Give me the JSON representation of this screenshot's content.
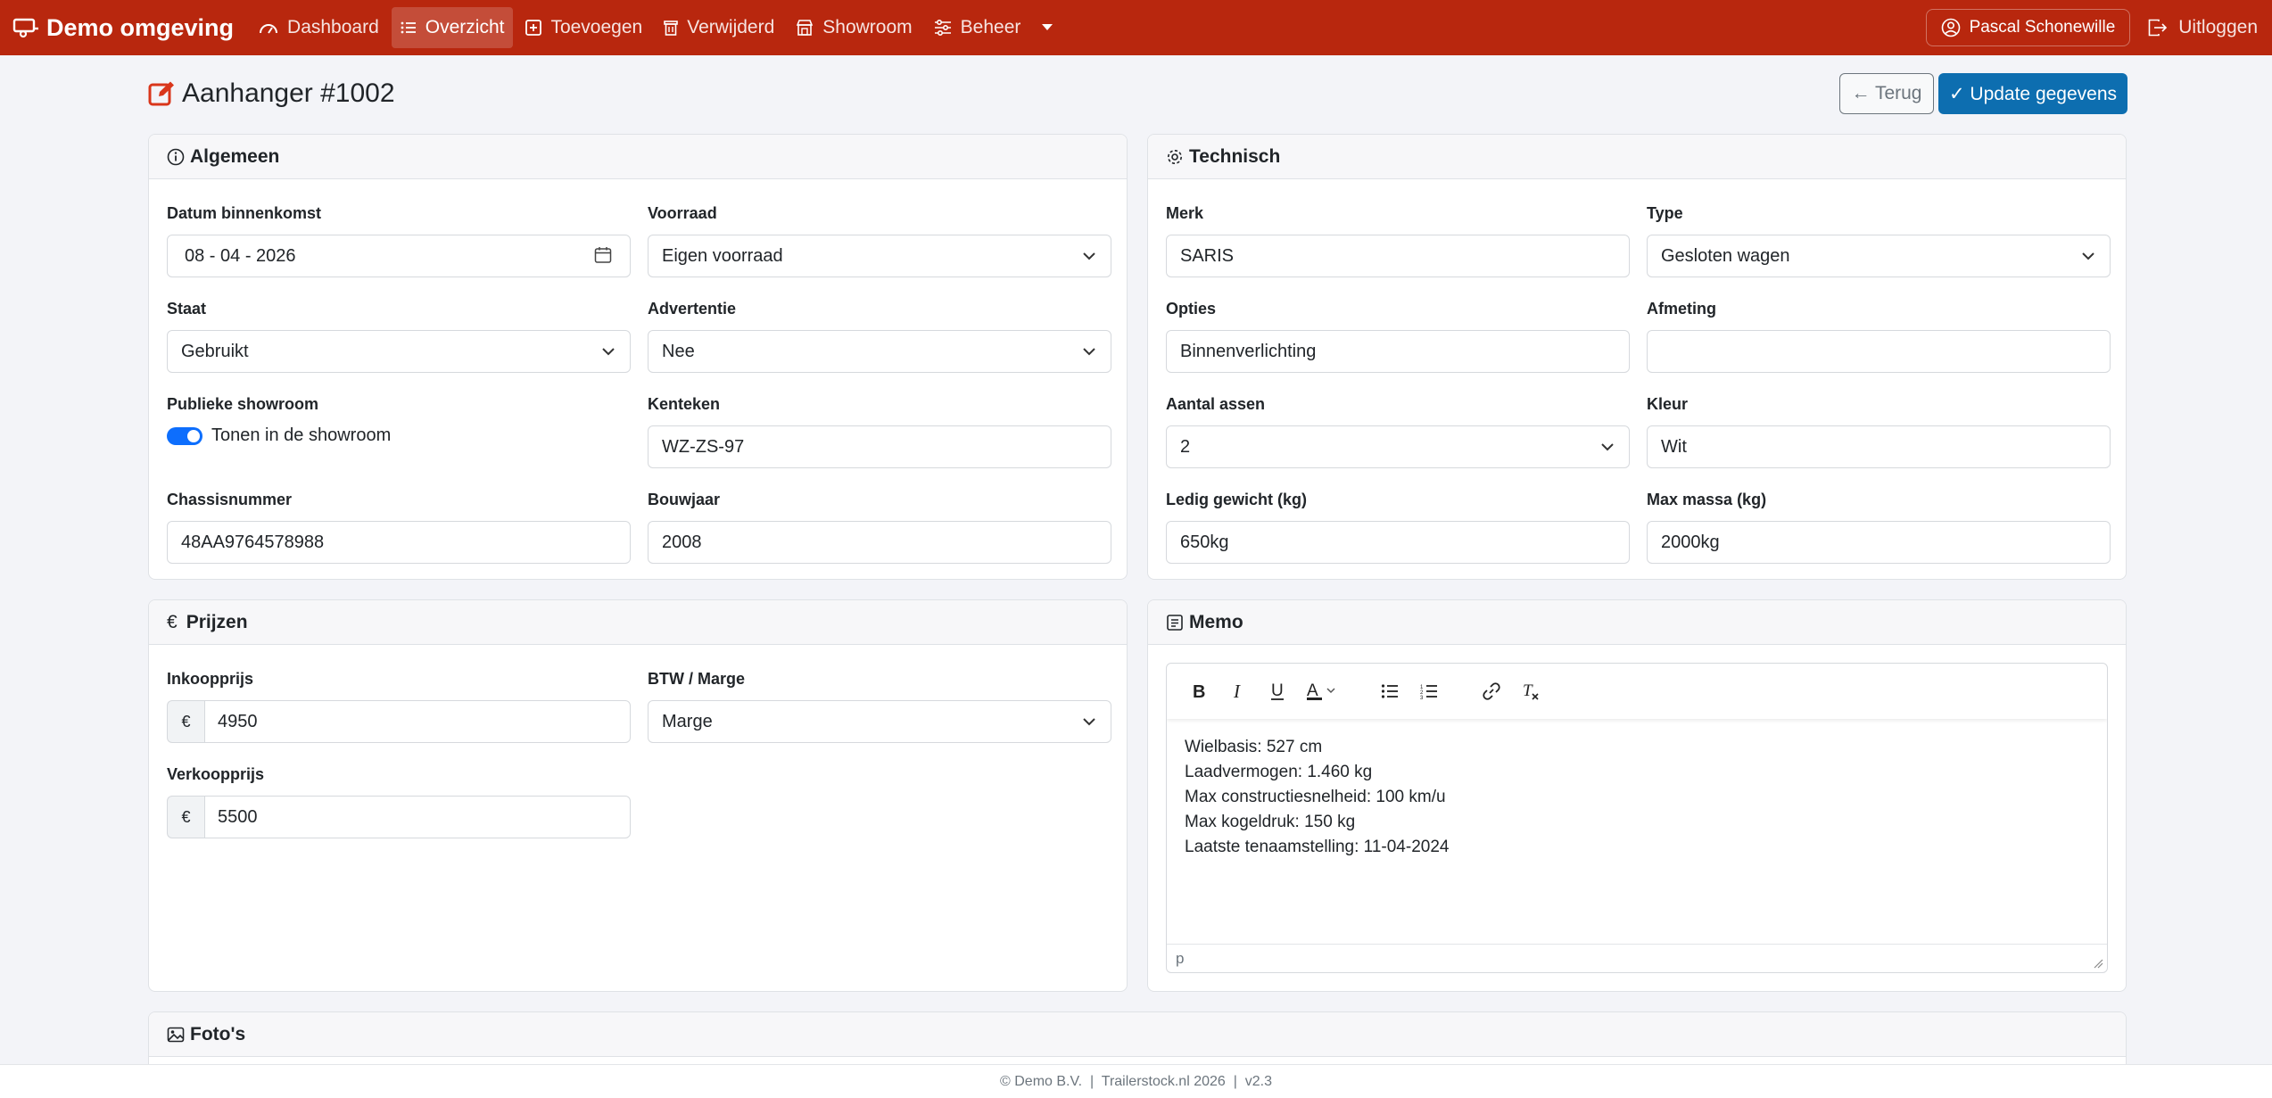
{
  "navbar": {
    "brand": "Demo omgeving",
    "items": [
      {
        "label": "Dashboard",
        "icon": "dashboard-icon"
      },
      {
        "label": "Overzicht",
        "icon": "list-icon",
        "active": true
      },
      {
        "label": "Toevoegen",
        "icon": "plus-square-icon"
      },
      {
        "label": "Verwijderd",
        "icon": "trash-icon"
      },
      {
        "label": "Showroom",
        "icon": "shop-icon"
      },
      {
        "label": "Beheer",
        "icon": "sliders-icon"
      }
    ],
    "user": "Pascal Schonewille",
    "logout": "Uitloggen",
    "color": "#b8270e"
  },
  "header": {
    "title": "Aanhanger #1002",
    "back_label": "← Terug",
    "update_label": "✓ Update gegevens"
  },
  "algemeen": {
    "title": "Algemeen",
    "datum_label": "Datum binnenkomst",
    "datum_value": "08 - 04 - 2026",
    "voorraad_label": "Voorraad",
    "voorraad_value": "Eigen voorraad",
    "staat_label": "Staat",
    "staat_value": "Gebruikt",
    "advertentie_label": "Advertentie",
    "advertentie_value": "Nee",
    "showroom_label": "Publieke showroom",
    "showroom_switch_label": "Tonen in de showroom",
    "kenteken_label": "Kenteken",
    "kenteken_value": "WZ-ZS-97",
    "chassis_label": "Chassisnummer",
    "chassis_value": "48AA9764578988",
    "bouwjaar_label": "Bouwjaar",
    "bouwjaar_value": "2008"
  },
  "technisch": {
    "title": "Technisch",
    "merk_label": "Merk",
    "merk_value": "SARIS",
    "type_label": "Type",
    "type_value": "Gesloten wagen",
    "opties_label": "Opties",
    "opties_value": "Binnenverlichting",
    "afmeting_label": "Afmeting",
    "afmeting_value": "",
    "assen_label": "Aantal assen",
    "assen_value": "2",
    "kleur_label": "Kleur",
    "kleur_value": "Wit",
    "ledig_label": "Ledig gewicht (kg)",
    "ledig_value": "650kg",
    "max_label": "Max massa (kg)",
    "max_value": "2000kg"
  },
  "prijzen": {
    "title": "Prijzen",
    "currency": "€",
    "inkoop_label": "Inkoopprijs",
    "inkoop_value": "4950",
    "btw_label": "BTW / Marge",
    "btw_value": "Marge",
    "verkoop_label": "Verkoopprijs",
    "verkoop_value": "5500"
  },
  "memo": {
    "title": "Memo",
    "lines": [
      "Wielbasis: 527 cm",
      "Laadvermogen: 1.460 kg",
      "Max constructiesnelheid: 100 km/u",
      "Max kogeldruk: 150 kg",
      "Laatste tenaamstelling: 11-04-2024"
    ],
    "statusbar": "p"
  },
  "fotos": {
    "title": "Foto's"
  },
  "footer": "© Demo B.V.  |  Trailerstock.nl 2026  |  v2.3"
}
